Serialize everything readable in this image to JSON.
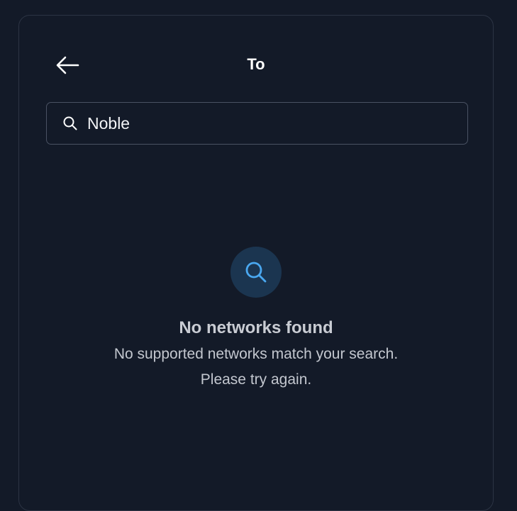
{
  "header": {
    "title": "To",
    "back_icon": "arrow-left-icon"
  },
  "search": {
    "value": "Noble",
    "placeholder": "",
    "icon": "search-icon"
  },
  "empty_state": {
    "icon": "search-icon",
    "title": "No networks found",
    "message_line1": "No supported networks match your search.",
    "message_line2": "Please try again."
  },
  "colors": {
    "background": "#131a28",
    "border": "#2c3444",
    "icon_circle": "#1b3550",
    "icon_accent": "#4aa8f0"
  }
}
